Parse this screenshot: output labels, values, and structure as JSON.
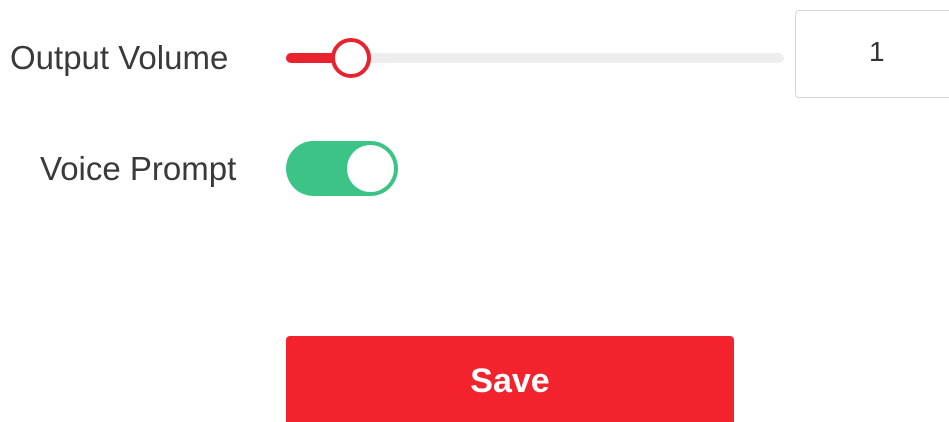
{
  "settings": {
    "output_volume": {
      "label": "Output Volume",
      "value": "1",
      "slider_level": 0.13
    },
    "voice_prompt": {
      "label": "Voice Prompt",
      "enabled": true
    }
  },
  "actions": {
    "save_label": "Save"
  },
  "colors": {
    "accent": "#e8232f",
    "toggle_on": "#3cc487",
    "save_button": "#f3232d",
    "track": "#eeeeee"
  }
}
